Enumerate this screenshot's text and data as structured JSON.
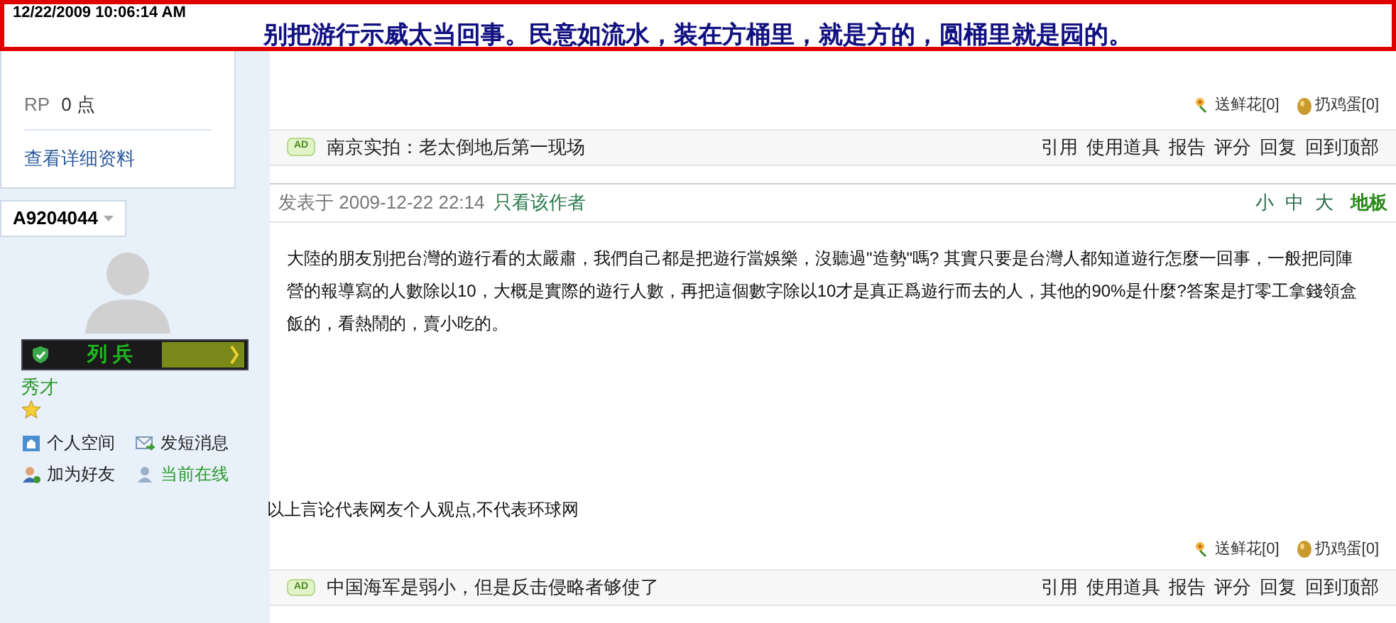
{
  "banner": {
    "timestamp": "12/22/2009 10:06:14 AM",
    "headline": "别把游行示威太当回事。民意如流水，装在方桶里，就是方的，圆桶里就是园的。"
  },
  "prev_post": {
    "profile": [
      {
        "label": "RP",
        "value": "0 点"
      }
    ],
    "profile_link": "查看详细资料",
    "actions": [
      {
        "kind": "flower",
        "label": "送鲜花[0]"
      },
      {
        "kind": "egg",
        "label": "扔鸡蛋[0]"
      }
    ],
    "ad_badge": "AD",
    "ad_text": "南京实拍：老太倒地后第一现场",
    "links": [
      "引用",
      "使用道具",
      "报告",
      "评分",
      "回复",
      "回到顶部"
    ]
  },
  "post": {
    "author": "A9204044",
    "rank_title": "列 兵",
    "rank_progress": {
      "level": 1
    },
    "level_name": "秀才",
    "author_links": [
      {
        "kind": "home",
        "label": "个人空间"
      },
      {
        "kind": "message",
        "label": "发短消息"
      },
      {
        "kind": "friend",
        "label": "加为好友"
      },
      {
        "kind": "online",
        "label": "当前在线"
      }
    ],
    "posted_prefix": "发表于 2009-12-22 22:14",
    "only_author": "只看该作者",
    "font_sizes": [
      "小",
      "中",
      "大"
    ],
    "floor": "地板",
    "body": "大陸的朋友別把台灣的遊行看的太嚴肅，我們自己都是把遊行當娛樂，沒聽過\"造勢\"嗎? 其實只要是台灣人都知道遊行怎麼一回事，一般把同陣營的報導寫的人數除以10，大概是實際的遊行人數，再把這個數字除以10才是真正爲遊行而去的人，其他的90%是什麼?答案是打零工拿錢領盒飯的，看熱鬧的，賣小吃的。",
    "disclaimer": "以上言论代表网友个人观点,不代表环球网",
    "actions": [
      {
        "kind": "flower",
        "label": "送鲜花[0]"
      },
      {
        "kind": "egg",
        "label": "扔鸡蛋[0]"
      }
    ],
    "ad_badge": "AD",
    "ad_text": "中国海军是弱小，但是反击侵略者够使了",
    "links": [
      "引用",
      "使用道具",
      "报告",
      "评分",
      "回复",
      "回到顶部"
    ]
  }
}
